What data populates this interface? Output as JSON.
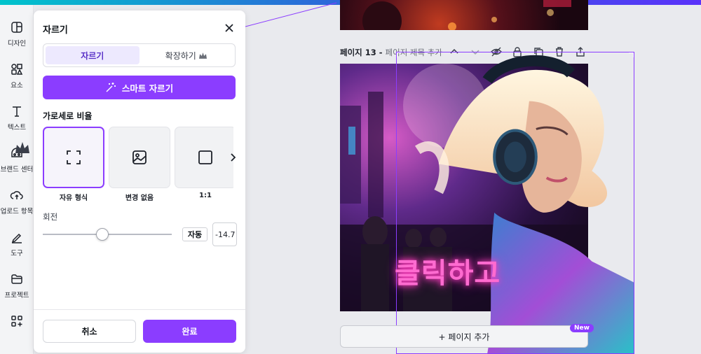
{
  "colors": {
    "accent": "#8b3dff",
    "accent_soft": "#ede9fe",
    "panel": "#ffffff",
    "canvas": "#e9eaee"
  },
  "sidebar": {
    "items": [
      {
        "label": "디자인",
        "icon": "layout-icon"
      },
      {
        "label": "요소",
        "icon": "shapes-icon"
      },
      {
        "label": "텍스트",
        "icon": "text-icon"
      },
      {
        "label": "브랜드 센터",
        "icon": "brand-icon"
      },
      {
        "label": "업로드 항목",
        "icon": "upload-icon"
      },
      {
        "label": "도구",
        "icon": "draw-icon"
      },
      {
        "label": "프로젝트",
        "icon": "folder-icon"
      },
      {
        "label": "",
        "icon": "apps-icon"
      }
    ]
  },
  "crop_panel": {
    "title": "자르기",
    "tabs": [
      {
        "label": "자르기",
        "active": true
      },
      {
        "label": "확장하기",
        "active": false
      }
    ],
    "smart_crop_label": "스마트 자르기",
    "ratio_title": "가로세로 비율",
    "ratios": [
      {
        "label": "자유 형식",
        "icon": "freeform-icon",
        "active": true
      },
      {
        "label": "변경 없음",
        "icon": "image-icon",
        "active": false
      },
      {
        "label": "1:1",
        "icon": "square-icon",
        "active": false
      }
    ],
    "rotate_label": "회전",
    "rotate_value": "-14.7",
    "rotation_fraction": 0.46,
    "auto_label": "자동",
    "cancel_label": "취소",
    "done_label": "완료"
  },
  "canvas": {
    "page_title_number": "페이지 13 -",
    "page_title_placeholder": "페이지 제목 추가",
    "add_page_label": "+ 페이지 추가",
    "new_badge": "New",
    "overlay_text": "클릭하고"
  }
}
